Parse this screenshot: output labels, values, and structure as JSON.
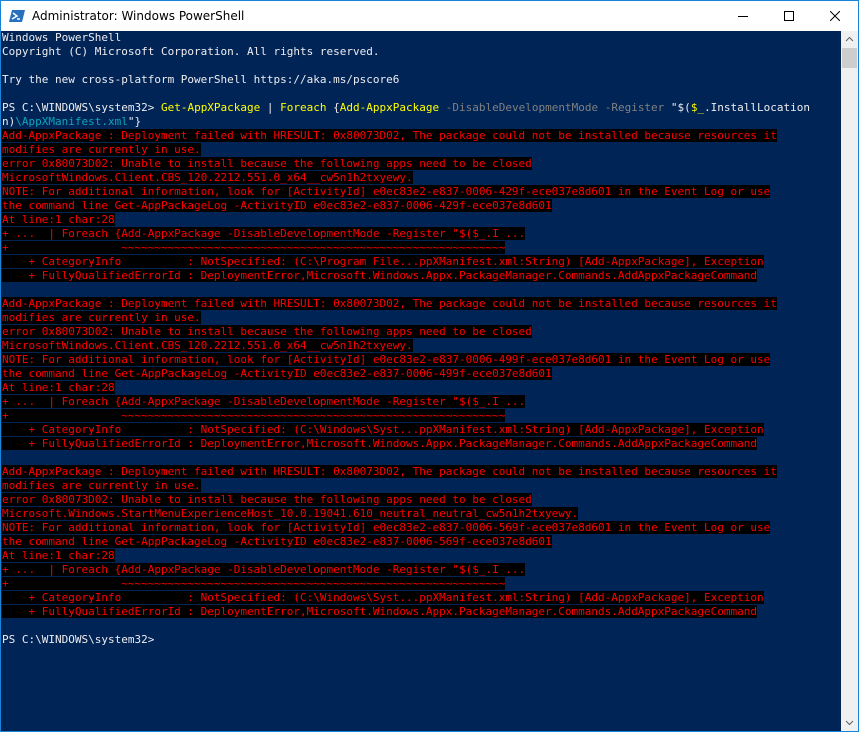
{
  "window": {
    "title": "Administrator: Windows PowerShell",
    "icon": "powershell-icon",
    "controls": [
      "minimize-icon",
      "maximize-icon",
      "close-icon"
    ]
  },
  "colors": {
    "background": "#012456",
    "text": "#eeedf0",
    "error_fg": "#ff0000",
    "error_bg": "#000000",
    "command": "#ffff00",
    "parameter": "#808080",
    "string_path": "#0ea5b9"
  },
  "console": {
    "banner": [
      "Windows PowerShell",
      "Copyright (C) Microsoft Corporation. All rights reserved.",
      "",
      "Try the new cross-platform PowerShell https://aka.ms/pscore6",
      ""
    ],
    "command_line": {
      "prompt": "PS C:\\WINDOWS\\system32> ",
      "cmd1": "Get-AppXPackage",
      "pipe": " | ",
      "cmd2": "Foreach",
      "brace": " {",
      "cmd3": "Add-AppxPackage",
      "param1": " -DisableDevelopmentMode",
      "param2": " -Register",
      "string_start": " \"$(",
      "variable": "$_",
      "property": ".InstallLocation",
      "string_cont": "n)",
      "string_path": "\\AppXManifest.xml",
      "string_end": "\"}"
    },
    "error_blocks": [
      [
        "Add-AppxPackage : Deployment failed with HRESULT: 0x80073D02, The package could not be installed because resources it",
        "modifies are currently in use.",
        "error 0x80073D02: Unable to install because the following apps need to be closed",
        "MicrosoftWindows.Client.CBS_120.2212.551.0_x64__cw5n1h2txyewy.",
        "NOTE: For additional information, look for [ActivityId] e0ec83e2-e837-0006-429f-ece037e8d601 in the Event Log or use",
        "the command line Get-AppPackageLog -ActivityID e0ec83e2-e837-0006-429f-ece037e8d601",
        "At line:1 char:28",
        "+ ...  | Foreach {Add-AppxPackage -DisableDevelopmentMode -Register \"$($_.I ...",
        "+                 ~~~~~~~~~~~~~~~~~~~~~~~~~~~~~~~~~~~~~~~~~~~~~~~~~~~~~~~~~~",
        "    + CategoryInfo          : NotSpecified: (C:\\Program File...ppXManifest.xml:String) [Add-AppxPackage], Exception",
        "    + FullyQualifiedErrorId : DeploymentError,Microsoft.Windows.Appx.PackageManager.Commands.AddAppxPackageCommand",
        ""
      ],
      [
        "Add-AppxPackage : Deployment failed with HRESULT: 0x80073D02, The package could not be installed because resources it",
        "modifies are currently in use.",
        "error 0x80073D02: Unable to install because the following apps need to be closed",
        "MicrosoftWindows.Client.CBS_120.2212.551.0_x64__cw5n1h2txyewy.",
        "NOTE: For additional information, look for [ActivityId] e0ec83e2-e837-0006-499f-ece037e8d601 in the Event Log or use",
        "the command line Get-AppPackageLog -ActivityID e0ec83e2-e837-0006-499f-ece037e8d601",
        "At line:1 char:28",
        "+ ...  | Foreach {Add-AppxPackage -DisableDevelopmentMode -Register \"$($_.I ...",
        "+                 ~~~~~~~~~~~~~~~~~~~~~~~~~~~~~~~~~~~~~~~~~~~~~~~~~~~~~~~~~~",
        "    + CategoryInfo          : NotSpecified: (C:\\Windows\\Syst...ppXManifest.xml:String) [Add-AppxPackage], Exception",
        "    + FullyQualifiedErrorId : DeploymentError,Microsoft.Windows.Appx.PackageManager.Commands.AddAppxPackageCommand",
        ""
      ],
      [
        "Add-AppxPackage : Deployment failed with HRESULT: 0x80073D02, The package could not be installed because resources it",
        "modifies are currently in use.",
        "error 0x80073D02: Unable to install because the following apps need to be closed",
        "Microsoft.Windows.StartMenuExperienceHost_10.0.19041.610_neutral_neutral_cw5n1h2txyewy.",
        "NOTE: For additional information, look for [ActivityId] e0ec83e2-e837-0006-569f-ece037e8d601 in the Event Log or use",
        "the command line Get-AppPackageLog -ActivityID e0ec83e2-e837-0006-569f-ece037e8d601",
        "At line:1 char:28",
        "+ ...  | Foreach {Add-AppxPackage -DisableDevelopmentMode -Register \"$($_.I ...",
        "+                 ~~~~~~~~~~~~~~~~~~~~~~~~~~~~~~~~~~~~~~~~~~~~~~~~~~~~~~~~~~",
        "    + CategoryInfo          : NotSpecified: (C:\\Windows\\Syst...ppXManifest.xml:String) [Add-AppxPackage], Exception",
        "    + FullyQualifiedErrorId : DeploymentError,Microsoft.Windows.Appx.PackageManager.Commands.AddAppxPackageCommand",
        ""
      ]
    ],
    "final_prompt": "PS C:\\WINDOWS\\system32>"
  }
}
